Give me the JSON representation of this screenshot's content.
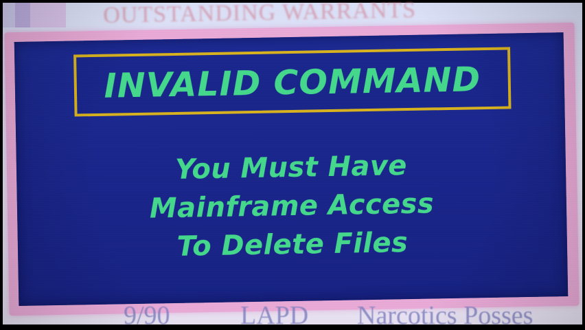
{
  "background": {
    "header_text": "OUTSTANDING WARRANTS",
    "bottom_row": {
      "date": "9/90",
      "agency": "LAPD",
      "charge": "Narcotics Posses"
    }
  },
  "dialog": {
    "title": "INVALID COMMAND",
    "message_lines": [
      "You Must Have",
      "Mainframe Access",
      "To Delete Files"
    ]
  },
  "colors": {
    "panel_blue": "#1c2a92",
    "frame_pink": "#e8a9d6",
    "text_green": "#44d78b",
    "border_gold": "#d7b11f"
  }
}
